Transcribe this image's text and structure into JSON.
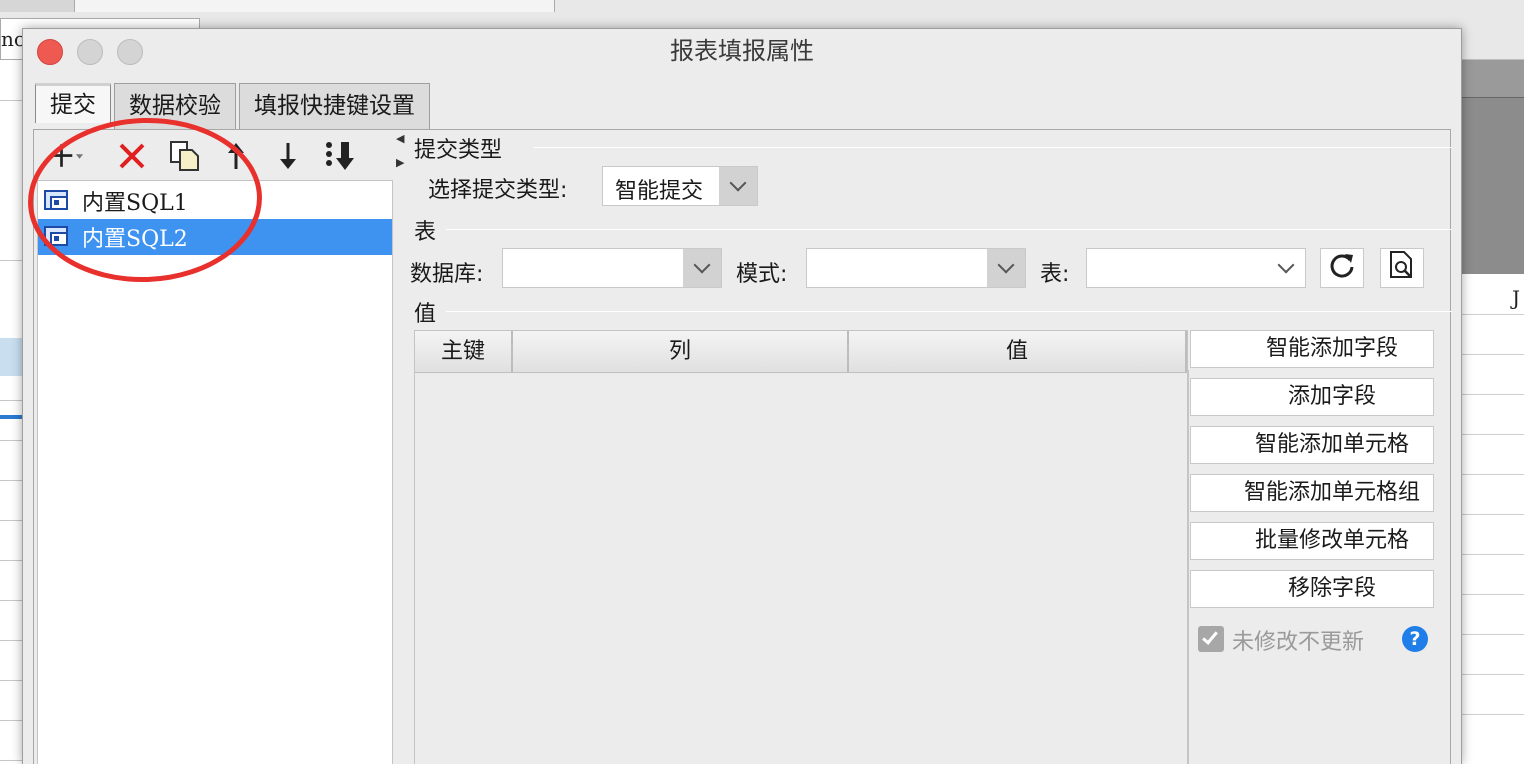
{
  "background": {
    "partial_input_text": "no",
    "column_label": "J"
  },
  "dialog": {
    "title": "报表填报属性",
    "tabs": [
      {
        "label": "提交"
      },
      {
        "label": "数据校验"
      },
      {
        "label": "填报快捷键设置"
      }
    ],
    "toolbar_icons": [
      "add-icon",
      "delete-icon",
      "copy-icon",
      "move-up-icon",
      "move-down-icon",
      "move-to-bottom-icon"
    ],
    "tree_items": [
      {
        "label": "内置SQL1",
        "selected": false
      },
      {
        "label": "内置SQL2",
        "selected": true
      }
    ],
    "submit_type": {
      "section_title": "提交类型",
      "label": "选择提交类型:",
      "selected": "智能提交"
    },
    "table_section": {
      "section_title": "表",
      "database_label": "数据库:",
      "database_value": "",
      "schema_label": "模式:",
      "schema_value": "",
      "table_label": "表:",
      "table_value": ""
    },
    "value_section": {
      "section_title": "值",
      "columns": [
        "主键",
        "列",
        "值"
      ],
      "rows": []
    },
    "buttons": [
      {
        "label": "智能添加字段"
      },
      {
        "label": "添加字段"
      },
      {
        "label": "智能添加单元格"
      },
      {
        "label": "智能添加单元格组"
      },
      {
        "label": "批量修改单元格"
      },
      {
        "label": "移除字段"
      }
    ],
    "checkbox": {
      "label": "未修改不更新",
      "checked": true,
      "disabled": true
    }
  },
  "colors": {
    "selection": "#3e93f0",
    "annotation": "#e8302c",
    "delete": "#e02020",
    "help": "#1f7ee8"
  }
}
